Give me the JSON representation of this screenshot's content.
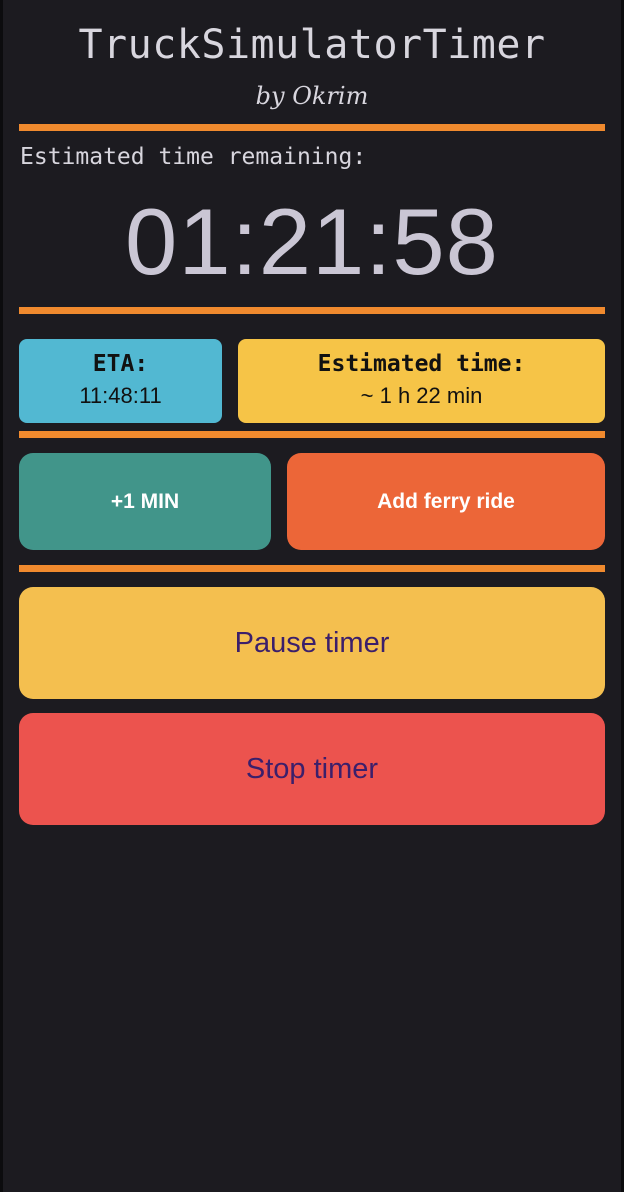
{
  "app": {
    "title": "TruckSimulatorTimer",
    "byline": "by Okrim"
  },
  "timer": {
    "remaining_label": "Estimated time remaining:",
    "remaining_value": "01:21:58"
  },
  "info": {
    "eta_label": "ETA:",
    "eta_value": "11:48:11",
    "estimated_label": "Estimated time:",
    "estimated_value": "~ 1 h 22 min"
  },
  "actions": {
    "plus_one_label": "+1 MIN",
    "ferry_label": "Add ferry ride",
    "pause_label": "Pause timer",
    "stop_label": "Stop timer"
  },
  "colors": {
    "background": "#1c1b20",
    "divider": "#f08a2e",
    "eta_card": "#52b8d2",
    "estimated_card": "#f6c447",
    "plus_one_button": "#41958a",
    "ferry_button": "#ec6638",
    "pause_button": "#f4bf4f",
    "stop_button": "#ec534e",
    "large_button_text": "#3b1f6b"
  }
}
